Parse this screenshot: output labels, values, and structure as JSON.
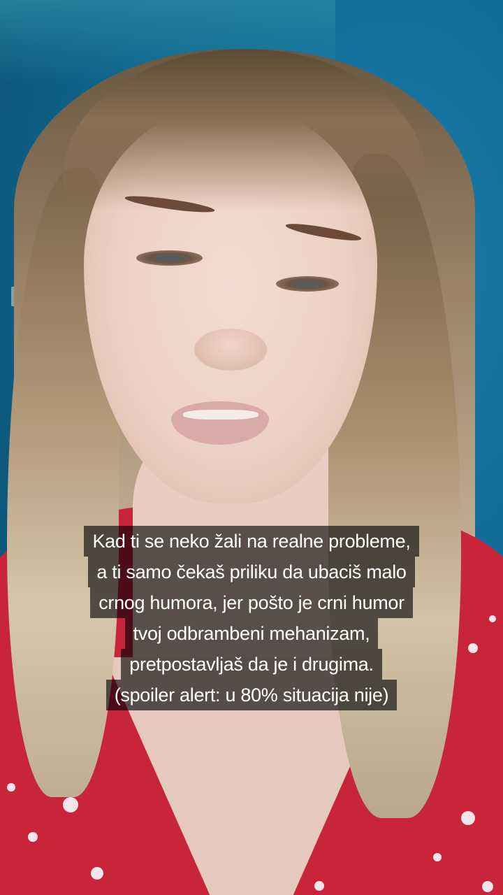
{
  "caption": {
    "lines": [
      "Kad ti se neko žali na realne probleme,",
      "a ti samo čekaš priliku da ubaciš malo",
      "crnog humora, jer pošto je crni humor",
      "tvoj odbrambeni mehanizam,",
      "pretpostavljaš da je i drugima.",
      "(spoiler alert: u 80% situacija nije)"
    ]
  },
  "colors": {
    "wall": "#126d98",
    "dress": "#c8253a",
    "caption_bg": "rgba(0,0,0,0.62)",
    "caption_text": "#ffffff"
  }
}
